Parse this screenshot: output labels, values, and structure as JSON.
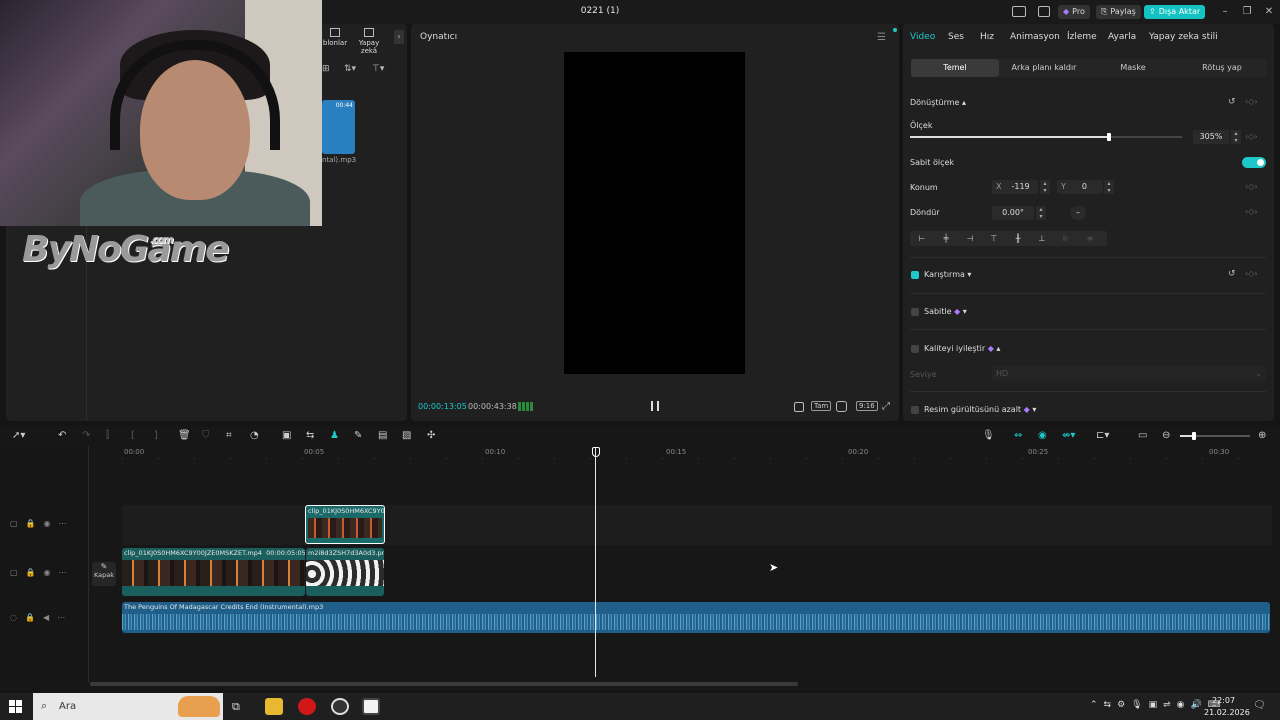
{
  "window": {
    "title": "0221 (1)",
    "pro_label": "Pro",
    "share_label": "Paylaş",
    "export_label": "Dışa Aktar"
  },
  "media": {
    "tab_templates": "blonlar",
    "tab_ai": "Yapay zekâ",
    "thumb_duration": "00:44",
    "thumb_name": "ntal).mp3"
  },
  "overlay": {
    "logo_text": "ByNoGame",
    "logo_suffix": ".com"
  },
  "player": {
    "title": "Oynatıcı",
    "current_time": "00:00:13:05",
    "total_time": "00:00:43:38",
    "btn_full": "Tam",
    "btn_ratio": "9:16"
  },
  "props": {
    "tabs": [
      "Video",
      "Ses",
      "Hız",
      "Animasyon",
      "İzleme",
      "Ayarla",
      "Yapay zeka stili"
    ],
    "subtabs": [
      "Temel",
      "Arka planı kaldır",
      "Maske",
      "Rötuş yap"
    ],
    "transform": "Dönüştürme",
    "scale_label": "Ölçek",
    "scale_value": "305%",
    "scale_fraction": 0.73,
    "uniform_scale": "Sabit ölçek",
    "position_label": "Konum",
    "x_label": "X",
    "x_value": "-119",
    "y_label": "Y",
    "y_value": "0",
    "rotate_label": "Döndür",
    "rotate_value": "0.00°",
    "rotate_dash": "–",
    "blend": "Karıştırma",
    "stabilize": "Sabitle",
    "enhance": "Kaliteyi iyileştir",
    "level_label": "Seviye",
    "level_value": "HD",
    "denoise": "Resim gürültüsünü azalt"
  },
  "timeline": {
    "ticks": [
      "00:00",
      "00:05",
      "00:10",
      "00:15",
      "00:20",
      "00:25",
      "00:30"
    ],
    "overlay_clip": "clip_01KJ0S0HM6XC9Y0",
    "main_clip": "clip_01KJ0S0HM6XC9Y00JZE0MSKZET.mp4",
    "main_clip_dur": "00:00:05:05",
    "second_clip": "m2i8d3ZSH7d3A0d3.png",
    "cover_label": "Kapak",
    "audio_clip": "The Penguins Of Madagascar Credits End (Instrumental).mp3"
  },
  "taskbar": {
    "search": "Ara",
    "time": "22:07",
    "date": "21.02.2026"
  },
  "colors": {
    "accent": "#1ec8c8",
    "pro": "#8a5cf6",
    "export": "#13c2c2"
  }
}
